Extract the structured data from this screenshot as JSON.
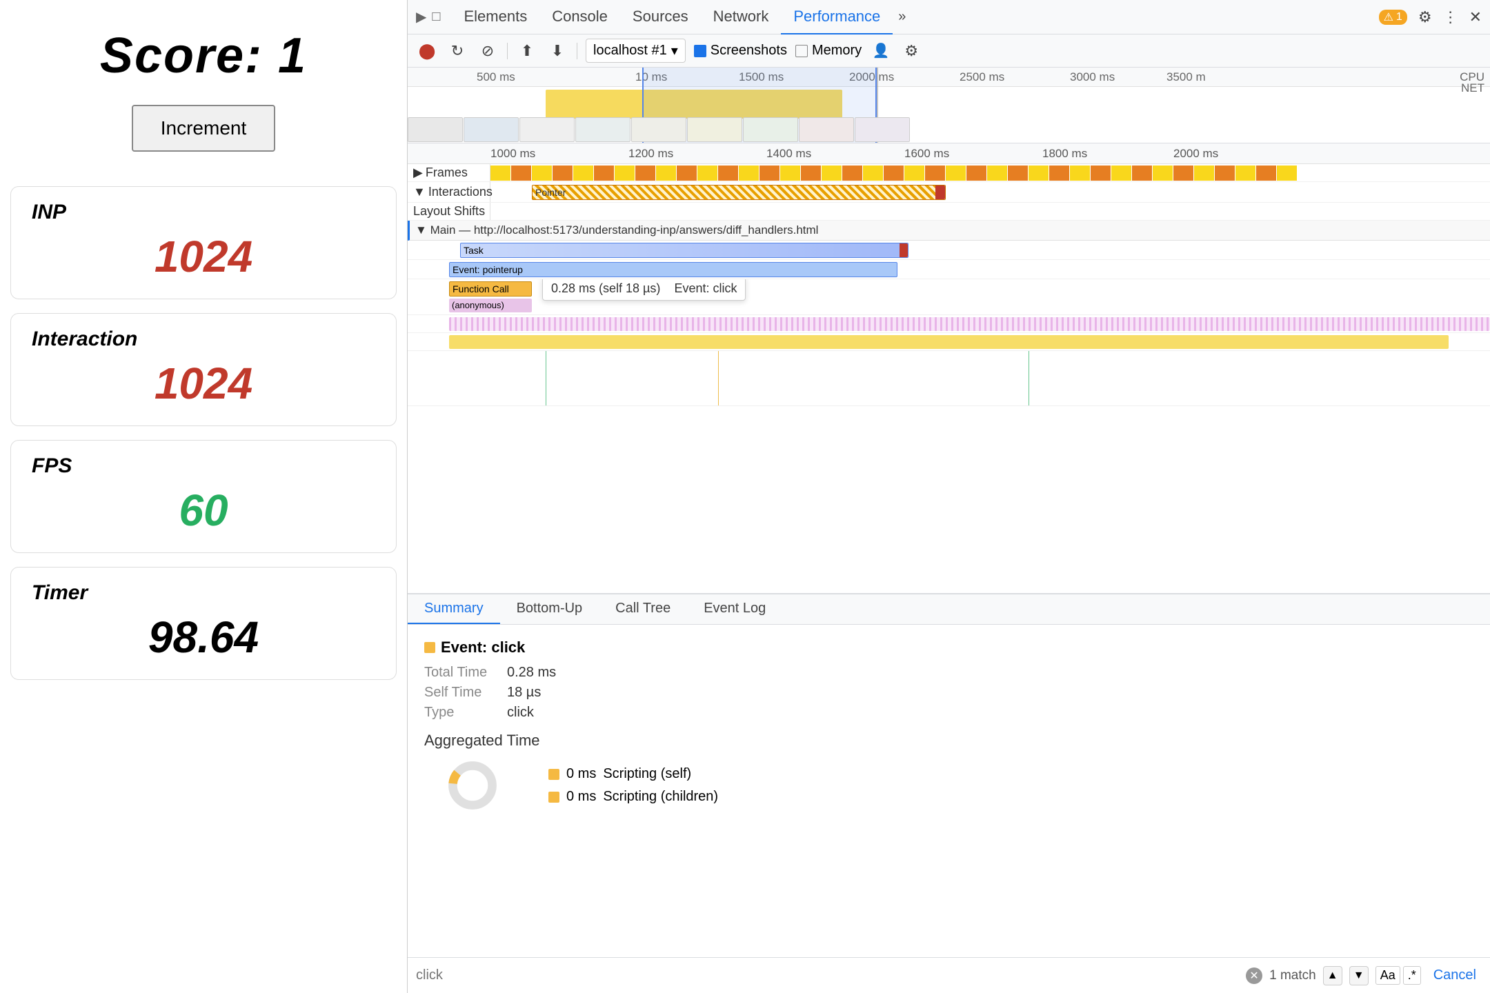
{
  "left": {
    "score_label": "Score: 1",
    "increment_btn": "Increment",
    "metrics": [
      {
        "id": "inp",
        "label": "INP",
        "value": "1024",
        "color": "red"
      },
      {
        "id": "interaction",
        "label": "Interaction",
        "value": "1024",
        "color": "red"
      },
      {
        "id": "fps",
        "label": "FPS",
        "value": "60",
        "color": "green"
      },
      {
        "id": "timer",
        "label": "Timer",
        "value": "98.64",
        "color": "black"
      }
    ]
  },
  "devtools": {
    "tabs": [
      "Elements",
      "Console",
      "Sources",
      "Network",
      "Performance"
    ],
    "active_tab": "Performance",
    "toolbar": {
      "source": "localhost #1",
      "screenshots_label": "Screenshots",
      "memory_label": "Memory"
    },
    "timeline": {
      "overview_labels": [
        "500 ms",
        "10 ms",
        "1500 ms",
        "2000 ms",
        "2500 ms",
        "3000 ms",
        "3500 m"
      ],
      "cpu_label": "CPU",
      "net_label": "NET"
    },
    "main_timeline": {
      "ruler_labels": [
        "1000 ms",
        "1200 ms",
        "1400 ms",
        "1600 ms",
        "1800 ms",
        "2000 ms"
      ],
      "tracks": {
        "frames": "Frames",
        "interactions": "Interactions",
        "pointer": "Pointer",
        "layout_shifts": "Layout Shifts",
        "main_thread": "Main — http://localhost:5173/understanding-inp/answers/diff_handlers.html",
        "task": "Task",
        "pointerup": "Event: pointerup",
        "function_call": "Function Call",
        "anonymous": "(anonymous)"
      }
    },
    "tooltip": {
      "time": "0.28 ms (self 18 µs)",
      "event": "Event: click"
    }
  },
  "bottom_panel": {
    "tabs": [
      "Summary",
      "Bottom-Up",
      "Call Tree",
      "Event Log"
    ],
    "active_tab": "Summary",
    "event_title": "Event: click",
    "details": [
      {
        "key": "Total Time",
        "value": "0.28 ms"
      },
      {
        "key": "Self Time",
        "value": "18 µs"
      },
      {
        "key": "Type",
        "value": "click"
      }
    ],
    "aggregated_title": "Aggregated Time",
    "legend": [
      {
        "label": "Scripting (self)",
        "value": "0 ms",
        "color": "#f5b942"
      },
      {
        "label": "Scripting (children)",
        "value": "0 ms",
        "color": "#f5b942"
      }
    ]
  },
  "search": {
    "placeholder": "click",
    "match_text": "1 match",
    "match_count_label": "1 match",
    "cancel_label": "Cancel",
    "aa_label": "Aa",
    "dot_label": ".*"
  }
}
